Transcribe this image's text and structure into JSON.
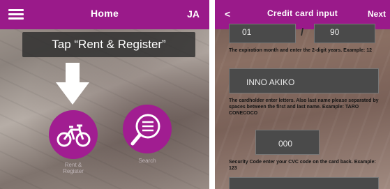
{
  "left_screen": {
    "header": {
      "title": "Home",
      "language": "JA"
    },
    "instruction": "Tap “Rent & Register”",
    "buttons": {
      "rent_icon": "bicycle-icon",
      "rent_label": "Rent &\nRegister",
      "search_icon": "search-icon",
      "search_label": "Search"
    }
  },
  "right_screen": {
    "header": {
      "back": "<",
      "title": "Credit card input",
      "next": "Next"
    },
    "expiry": {
      "month": "01",
      "separator": "/",
      "year": "90",
      "help": "The expiration month and enter the 2-digit years. Example: 12"
    },
    "cardholder": {
      "value": "INNO AKIKO",
      "help": "The cardholder enter letters. Also last name please separated by spaces between the first and last name. Example: TARO CONECOCO"
    },
    "cvc": {
      "value": "000",
      "help": "Security Code enter your CVC code on the card back. Example: 123"
    }
  },
  "colors": {
    "brand": "#9a1a8a",
    "instruction_bg": "#2d2d2d",
    "field_bg": "#4a4a4a"
  }
}
